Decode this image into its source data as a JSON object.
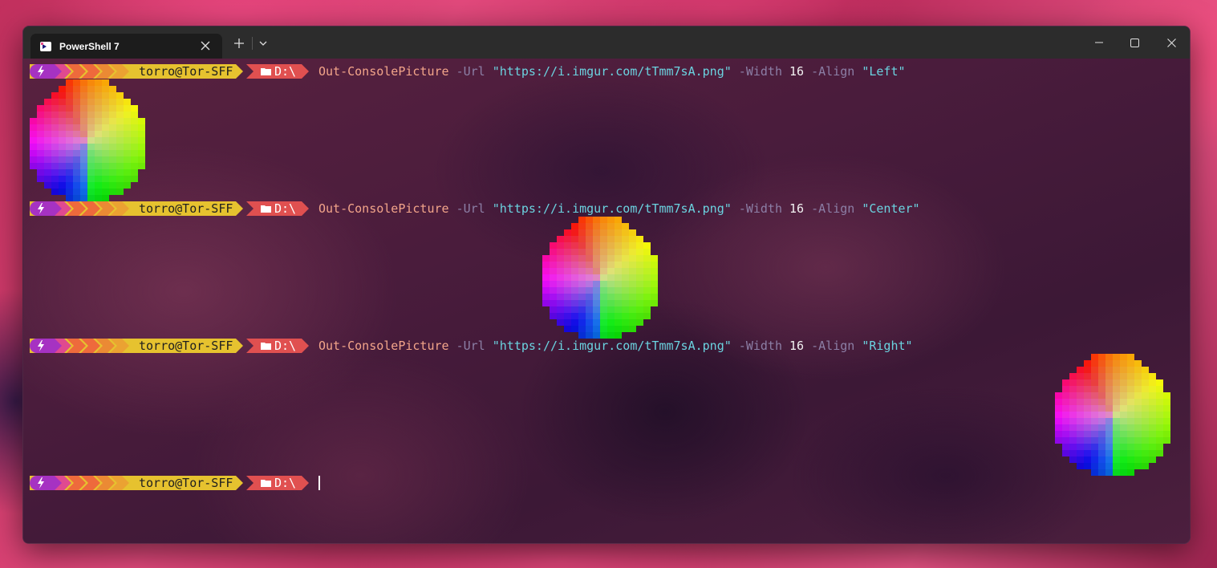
{
  "window": {
    "tab_title": "PowerShell 7",
    "tab_icon": "powershell-icon",
    "new_tab_icon": "plus-icon",
    "dropdown_icon": "chevron-down-icon",
    "minimize_icon": "minimize-icon",
    "maximize_icon": "maximize-icon",
    "close_icon": "close-icon"
  },
  "prompt": {
    "user": "torro@Tor-SFF",
    "path": "D:\\",
    "colors": {
      "purple": "#a632c2",
      "pink": "#e04a8f",
      "orange": "#ee6a3c",
      "amber": "#eba232",
      "yellow": "#e6c22f",
      "red": "#e05050"
    }
  },
  "lines": [
    {
      "command": "Out-ConsolePicture",
      "p1": "-Url",
      "url": "\"https://i.imgur.com/tTmm7sA.png\"",
      "p2": "-Width",
      "width": "16",
      "p3": "-Align",
      "align": "\"Left\""
    },
    {
      "command": "Out-ConsolePicture",
      "p1": "-Url",
      "url": "\"https://i.imgur.com/tTmm7sA.png\"",
      "p2": "-Width",
      "width": "16",
      "p3": "-Align",
      "align": "\"Center\""
    },
    {
      "command": "Out-ConsolePicture",
      "p1": "-Url",
      "url": "\"https://i.imgur.com/tTmm7sA.png\"",
      "p2": "-Width",
      "width": "16",
      "p3": "-Align",
      "align": "\"Right\""
    }
  ],
  "syntax_colors": {
    "command": "#f3a58a",
    "parameter": "#8c7fa6",
    "string": "#6bd3e0",
    "number": "#f2f2f2"
  }
}
